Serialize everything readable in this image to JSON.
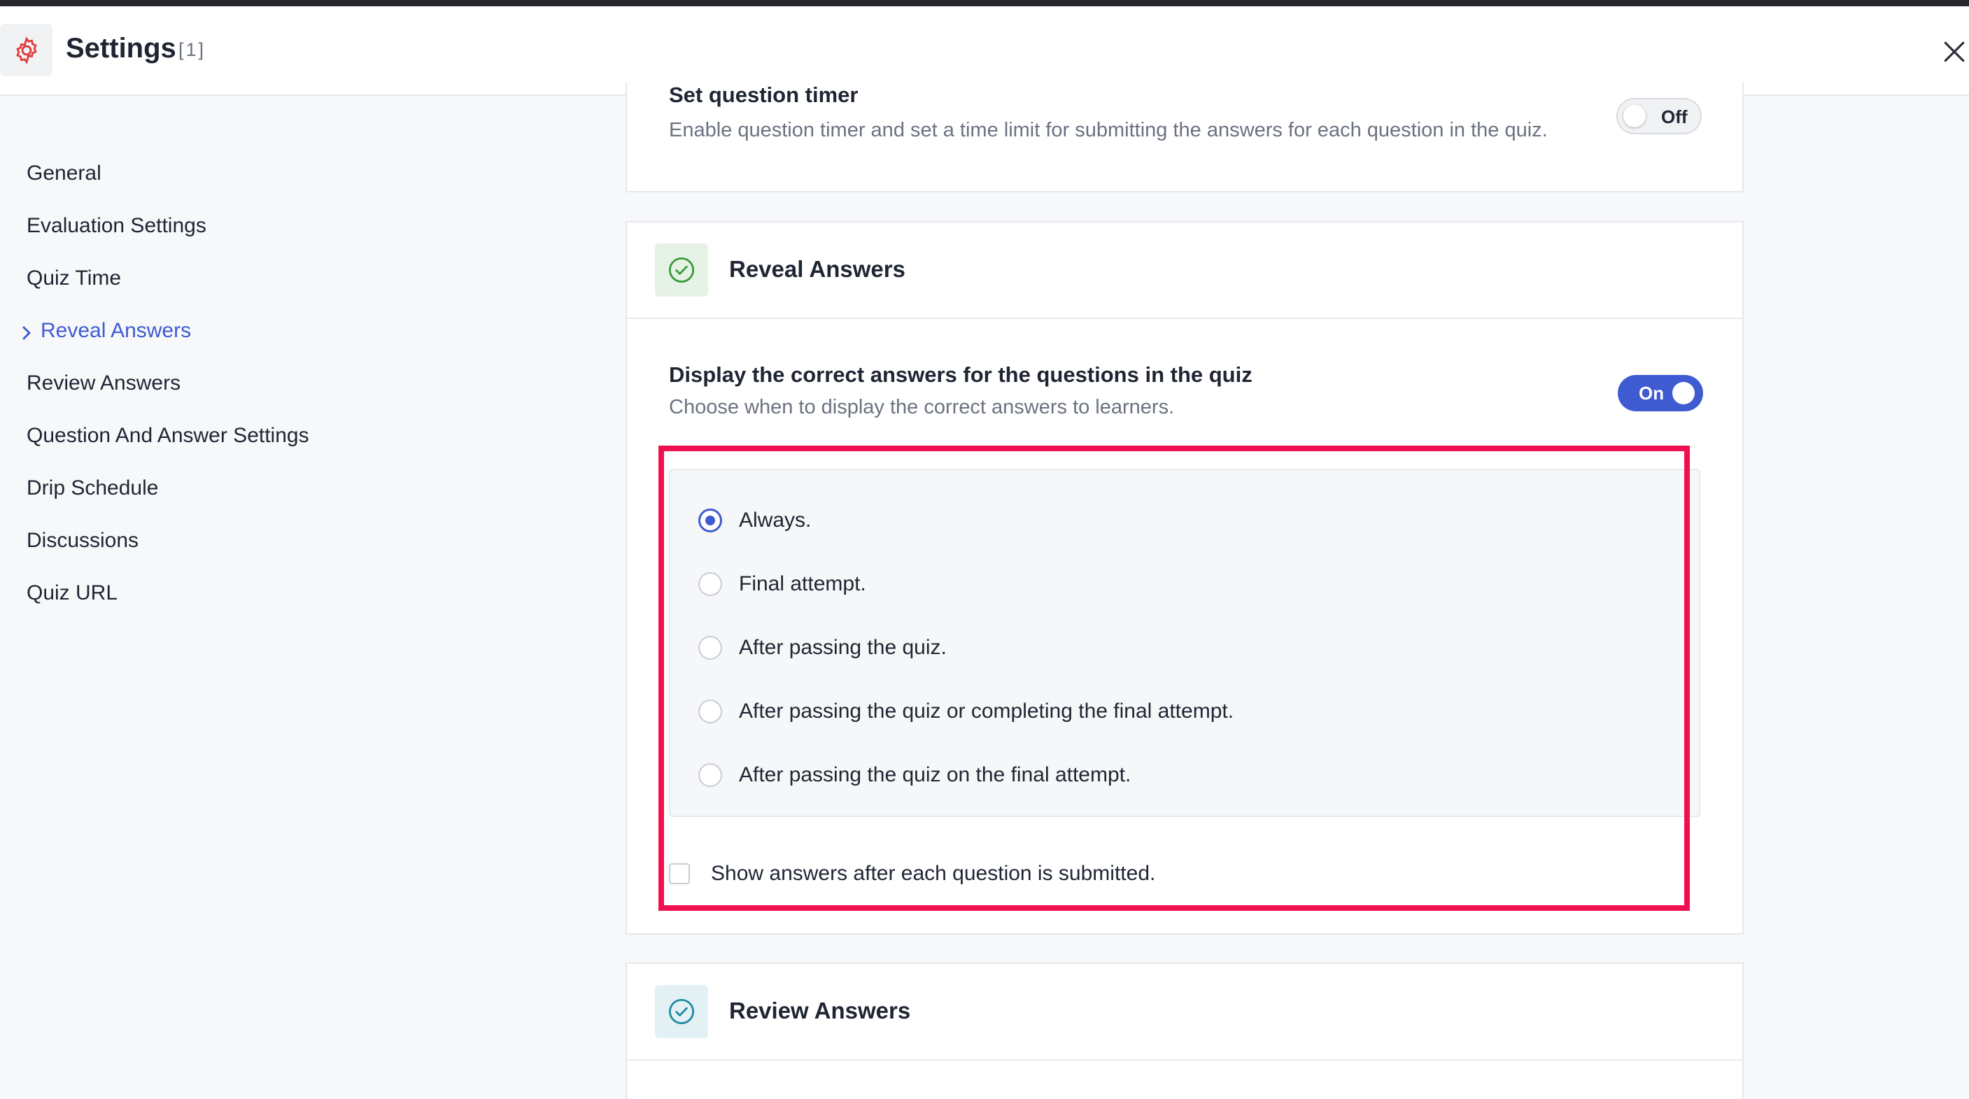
{
  "header": {
    "title": "Settings",
    "count": "[1]",
    "icon": "gear-icon",
    "close_icon": "close-icon",
    "accent_color": "#e03a3a"
  },
  "sidebar": {
    "items": [
      {
        "label": "General",
        "active": false
      },
      {
        "label": "Evaluation Settings",
        "active": false
      },
      {
        "label": "Quiz Time",
        "active": false
      },
      {
        "label": "Reveal Answers",
        "active": true
      },
      {
        "label": "Review Answers",
        "active": false
      },
      {
        "label": "Question And Answer Settings",
        "active": false
      },
      {
        "label": "Drip Schedule",
        "active": false
      },
      {
        "label": "Discussions",
        "active": false
      },
      {
        "label": "Quiz URL",
        "active": false
      }
    ],
    "active_color": "#3f5bd1"
  },
  "timer": {
    "title": "Set question timer",
    "description": "Enable question timer and set a time limit for submitting the answers for each question in the quiz.",
    "toggle_label": "Off",
    "toggle_state": false
  },
  "reveal": {
    "title": "Reveal Answers",
    "icon": "check-circle-icon",
    "display_title": "Display the correct answers for the questions in the quiz",
    "display_desc": "Choose when to display the correct answers to learners.",
    "toggle_label": "On",
    "toggle_state": true,
    "options": [
      {
        "label": "Always.",
        "selected": true
      },
      {
        "label": "Final attempt.",
        "selected": false
      },
      {
        "label": "After passing the quiz.",
        "selected": false
      },
      {
        "label": "After passing the quiz or completing the final attempt.",
        "selected": false
      },
      {
        "label": "After passing the quiz on the final attempt.",
        "selected": false
      }
    ],
    "checkbox_label": "Show answers after each question is submitted.",
    "checkbox_checked": false,
    "highlight_color": "#f0104f"
  },
  "review": {
    "title": "Review Answers",
    "icon": "check-circle-icon"
  }
}
